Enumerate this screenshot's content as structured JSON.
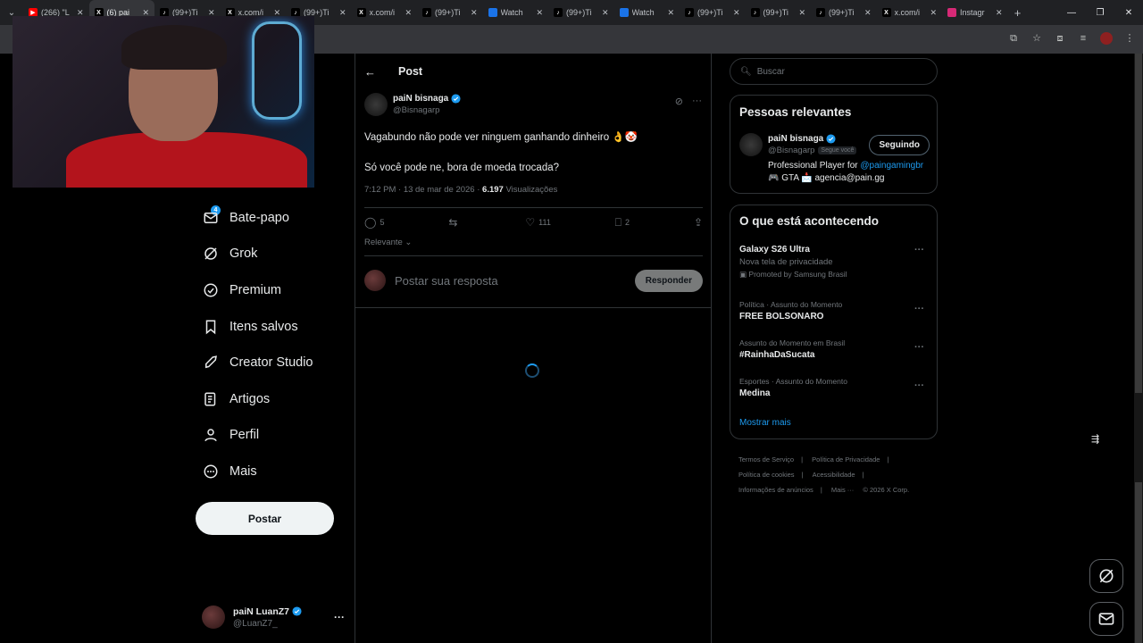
{
  "browser": {
    "tabs": [
      {
        "title": "(266) \"L",
        "icon": "youtube-icon",
        "color": "#ff0000"
      },
      {
        "title": "(6) pai",
        "icon": "x-icon",
        "color": "#000000"
      },
      {
        "title": "(99+)Ti",
        "icon": "tiktok-icon",
        "color": "#000000"
      },
      {
        "title": "x.com/i",
        "icon": "x-icon",
        "color": "#000000"
      },
      {
        "title": "(99+)Ti",
        "icon": "tiktok-icon",
        "color": "#000000"
      },
      {
        "title": "x.com/i",
        "icon": "x-icon",
        "color": "#000000"
      },
      {
        "title": "(99+)Ti",
        "icon": "tiktok-icon",
        "color": "#000000"
      },
      {
        "title": "Watch",
        "icon": "globe-icon",
        "color": "#1a73e8"
      },
      {
        "title": "(99+)Ti",
        "icon": "tiktok-icon",
        "color": "#000000"
      },
      {
        "title": "Watch",
        "icon": "globe-icon",
        "color": "#1a73e8"
      },
      {
        "title": "(99+)Ti",
        "icon": "tiktok-icon",
        "color": "#000000"
      },
      {
        "title": "(99+)Ti",
        "icon": "tiktok-icon",
        "color": "#000000"
      },
      {
        "title": "(99+)Ti",
        "icon": "tiktok-icon",
        "color": "#000000"
      },
      {
        "title": "x.com/i",
        "icon": "x-icon",
        "color": "#000000"
      },
      {
        "title": "Instagr",
        "icon": "instagram-icon",
        "color": "#d62976"
      }
    ],
    "active_tab": 1
  },
  "nav": {
    "badge": "4",
    "items": [
      {
        "label": "Bate-papo",
        "icon": "chat-icon"
      },
      {
        "label": "Grok",
        "icon": "grok-icon"
      },
      {
        "label": "Premium",
        "icon": "premium-icon"
      },
      {
        "label": "Itens salvos",
        "icon": "bookmark-icon"
      },
      {
        "label": "Creator Studio",
        "icon": "rocket-icon"
      },
      {
        "label": "Artigos",
        "icon": "articles-icon"
      },
      {
        "label": "Perfil",
        "icon": "profile-icon"
      },
      {
        "label": "Mais",
        "icon": "more-icon"
      }
    ],
    "post_button": "Postar",
    "account": {
      "name": "paiN LuanZ7",
      "handle": "@LuanZ7_"
    }
  },
  "post": {
    "header_title": "Post",
    "author": {
      "name": "paiN bisnaga",
      "handle": "@Bisnagarp"
    },
    "text_line1": "Vagabundo não pode ver ninguem ganhando dinheiro 👌🤡",
    "text_line2": "Só você pode ne, bora de moeda trocada?",
    "time": "7:12 PM · 13 de mar de 2026 · ",
    "views_count": "6.197",
    "views_label": "Visualizações",
    "replies": "5",
    "reposts": "",
    "likes": "111",
    "bookmarks": "2",
    "sort": "Relevante",
    "reply_placeholder": "Postar sua resposta",
    "reply_button": "Responder"
  },
  "sidebar": {
    "search_placeholder": "Buscar",
    "relevant_title": "Pessoas relevantes",
    "relevant_person": {
      "name": "paiN bisnaga",
      "handle": "@Bisnagarp",
      "follows_you": "Segue você",
      "follow_button": "Seguindo",
      "bio_prefix": "Professional Player for ",
      "bio_link": "@paingamingbr",
      "bio_line2": "🎮 GTA 📩 agencia@pain.gg"
    },
    "trending_title": "O que está acontecendo",
    "trends": [
      {
        "category": "",
        "title": "Galaxy S26 Ultra",
        "subtitle": "Nova tela de privacidade",
        "promo": "Promoted by Samsung Brasil"
      },
      {
        "category": "Política · Assunto do Momento",
        "title": "FREE BOLSONARO",
        "subtitle": "",
        "promo": ""
      },
      {
        "category": "Assunto do Momento em Brasil",
        "title": "#RainhaDaSucata",
        "subtitle": "",
        "promo": ""
      },
      {
        "category": "Esportes · Assunto do Momento",
        "title": "Medina",
        "subtitle": "",
        "promo": ""
      }
    ],
    "show_more": "Mostrar mais",
    "footer": [
      "Termos de Serviço",
      "Política de Privacidade",
      "Política de cookies",
      "Acessibilidade",
      "Informações de anúncios",
      "Mais ···",
      "© 2026 X Corp."
    ]
  }
}
